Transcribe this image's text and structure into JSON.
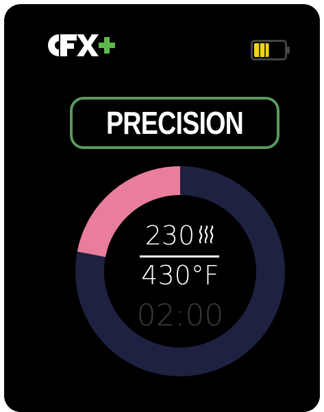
{
  "brand": {
    "logo_text": "CFX+"
  },
  "status": {
    "battery_level": 0.5,
    "battery_color": "#f2d21b"
  },
  "mode": {
    "label": "PRECISION",
    "border_color": "#5a9960"
  },
  "dial": {
    "progress": 0.22,
    "progress_color": "#e87e9b",
    "track_color": "#1e2140",
    "setpoint": "230",
    "setpoint_icon": "smoke-icon",
    "temperature": "430°F",
    "timer": "02:00"
  }
}
